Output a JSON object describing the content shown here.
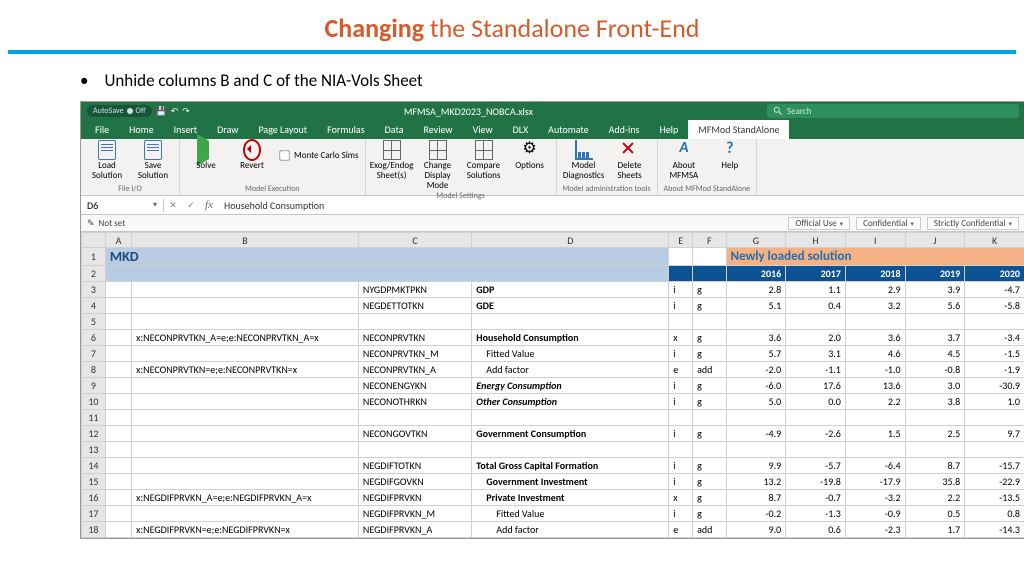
{
  "slide": {
    "title_bold": "Changing",
    "title_rest": " the Standalone Front-End",
    "bullet": "Unhide columns B and C of the NIA-Vols Sheet"
  },
  "excel": {
    "filename": "MFMSA_MKD2023_NOBCA.xlsx",
    "search_placeholder": "Search",
    "autosave_label": "AutoSave",
    "autosave_state": "Off",
    "tabs": [
      "File",
      "Home",
      "Insert",
      "Draw",
      "Page Layout",
      "Formulas",
      "Data",
      "Review",
      "View",
      "DLX",
      "Automate",
      "Add-ins",
      "Help",
      "MFMod StandAlone"
    ],
    "active_tab": "MFMod StandAlone",
    "ribbon_groups": [
      {
        "label": "File I/O",
        "buttons": [
          "Load Solution",
          "Save Solution"
        ]
      },
      {
        "label": "Model Execution",
        "buttons": [
          "Solve",
          "Revert"
        ],
        "checkbox": "Monte Carlo Sims"
      },
      {
        "label": "Model Settings",
        "buttons": [
          "Exog/Endog Sheet(s)",
          "Change Display Mode",
          "Compare Solutions",
          "Options"
        ]
      },
      {
        "label": "Model administration tools",
        "buttons": [
          "Model Diagnostics",
          "Delete Sheets"
        ]
      },
      {
        "label": "About MFMod StandAlone",
        "buttons": [
          "About MFMSA",
          "Help"
        ]
      }
    ],
    "namebox": "D6",
    "formula": "Household Consumption",
    "sensitivity": {
      "not_set": "Not set",
      "options": [
        "Official Use",
        "Confidential",
        "Strictly Confidential"
      ]
    },
    "columns": [
      "A",
      "B",
      "C",
      "D",
      "E",
      "F",
      "G",
      "H",
      "I",
      "J",
      "K"
    ],
    "hdr": {
      "mkd": "MKD",
      "newly": "Newly loaded solution",
      "years": [
        "2016",
        "2017",
        "2018",
        "2019",
        "2020"
      ]
    },
    "rows": [
      {
        "n": 3,
        "B": "",
        "C": "NYGDPMKTPKN",
        "D": "GDP",
        "E": "i",
        "F": "g",
        "bold": true,
        "G": "2.8",
        "H": "1.1",
        "I": "2.9",
        "J": "3.9",
        "K": "-4.7"
      },
      {
        "n": 4,
        "B": "",
        "C": "NEGDETTOTKN",
        "D": "GDE",
        "E": "i",
        "F": "g",
        "bold": true,
        "G": "5.1",
        "H": "0.4",
        "I": "3.2",
        "J": "5.6",
        "K": "-5.8"
      },
      {
        "n": 5
      },
      {
        "n": 6,
        "B": "x:NECONPRVTKN_A=e;e:NECONPRVTKN_A=x",
        "C": "NECONPRVTKN",
        "D": "Household Consumption",
        "E": "x",
        "F": "g",
        "bold": true,
        "G": "3.6",
        "H": "2.0",
        "I": "3.6",
        "J": "3.7",
        "K": "-3.4"
      },
      {
        "n": 7,
        "B": "",
        "C": "NECONPRVTKN_M",
        "D": "Fitted Value",
        "E": "i",
        "F": "g",
        "ind": 1,
        "G": "5.7",
        "H": "3.1",
        "I": "4.6",
        "J": "4.5",
        "K": "-1.5"
      },
      {
        "n": 8,
        "B": "x:NECONPRVTKN=e;e:NECONPRVTKN=x",
        "C": "NECONPRVTKN_A",
        "D": "Add factor",
        "E": "e",
        "F": "add",
        "ind": 1,
        "G": "-2.0",
        "H": "-1.1",
        "I": "-1.0",
        "J": "-0.8",
        "K": "-1.9"
      },
      {
        "n": 9,
        "B": "",
        "C": "NECONENGYKN",
        "D": "Energy Consumption",
        "E": "i",
        "F": "g",
        "bold": true,
        "ital": true,
        "G": "-6.0",
        "H": "17.6",
        "I": "13.6",
        "J": "3.0",
        "K": "-30.9"
      },
      {
        "n": 10,
        "B": "",
        "C": "NECONOTHRKN",
        "D": "Other Consumption",
        "E": "i",
        "F": "g",
        "bold": true,
        "ital": true,
        "G": "5.0",
        "H": "0.0",
        "I": "2.2",
        "J": "3.8",
        "K": "1.0"
      },
      {
        "n": 11
      },
      {
        "n": 12,
        "B": "",
        "C": "NECONGOVTKN",
        "D": "Government Consumption",
        "E": "i",
        "F": "g",
        "bold": true,
        "G": "-4.9",
        "H": "-2.6",
        "I": "1.5",
        "J": "2.5",
        "K": "9.7"
      },
      {
        "n": 13
      },
      {
        "n": 14,
        "B": "",
        "C": "NEGDIFTOTKN",
        "D": "Total Gross Capital Formation",
        "E": "i",
        "F": "g",
        "bold": true,
        "G": "9.9",
        "H": "-5.7",
        "I": "-6.4",
        "J": "8.7",
        "K": "-15.7"
      },
      {
        "n": 15,
        "B": "",
        "C": "NEGDIFGOVKN",
        "D": "Government Investment",
        "E": "i",
        "F": "g",
        "bold": true,
        "ind": 1,
        "G": "13.2",
        "H": "-19.8",
        "I": "-17.9",
        "J": "35.8",
        "K": "-22.9"
      },
      {
        "n": 16,
        "B": "x:NEGDIFPRVKN_A=e;e:NEGDIFPRVKN_A=x",
        "C": "NEGDIFPRVKN",
        "D": "Private Investment",
        "E": "x",
        "F": "g",
        "bold": true,
        "ind": 1,
        "G": "8.7",
        "H": "-0.7",
        "I": "-3.2",
        "J": "2.2",
        "K": "-13.5"
      },
      {
        "n": 17,
        "B": "",
        "C": "NEGDIFPRVKN_M",
        "D": "Fitted Value",
        "E": "i",
        "F": "g",
        "ind": 2,
        "G": "-0.2",
        "H": "-1.3",
        "I": "-0.9",
        "J": "0.5",
        "K": "0.8"
      },
      {
        "n": 18,
        "B": "x:NEGDIFPRVKN=e;e:NEGDIFPRVKN=x",
        "C": "NEGDIFPRVKN_A",
        "D": "Add factor",
        "E": "e",
        "F": "add",
        "ind": 2,
        "G": "9.0",
        "H": "0.6",
        "I": "-2.3",
        "J": "1.7",
        "K": "-14.3"
      }
    ]
  }
}
